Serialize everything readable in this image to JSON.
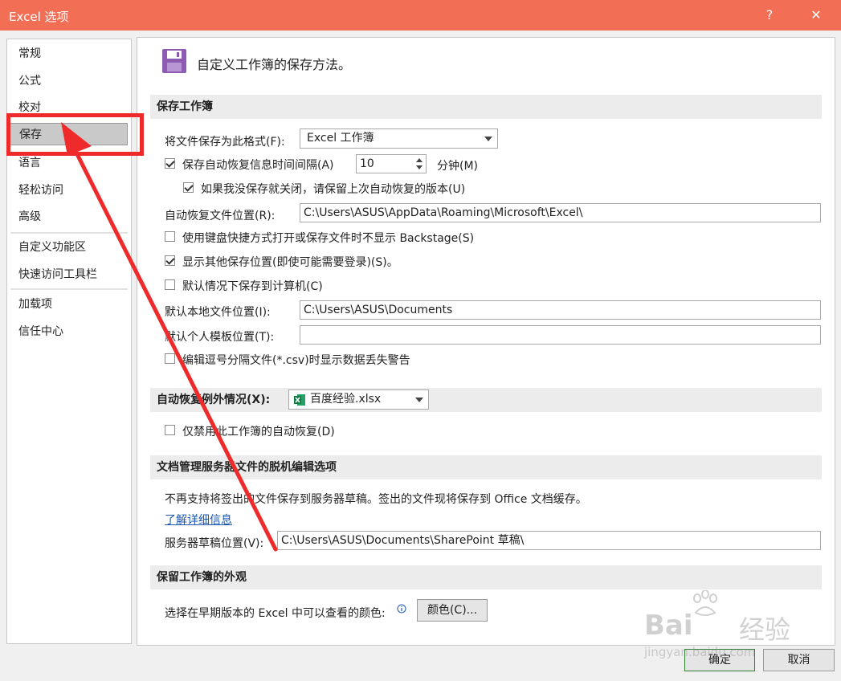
{
  "window": {
    "title": "Excel 选项",
    "help_label": "?",
    "close_label": "✕"
  },
  "sidebar": {
    "items": [
      {
        "label": "常规"
      },
      {
        "label": "公式"
      },
      {
        "label": "校对"
      },
      {
        "label": "保存"
      },
      {
        "label": "语言"
      },
      {
        "label": "轻松访问"
      },
      {
        "label": "高级"
      },
      {
        "label": "自定义功能区"
      },
      {
        "label": "快速访问工具栏"
      },
      {
        "label": "加载项"
      },
      {
        "label": "信任中心"
      }
    ],
    "selected": "保存"
  },
  "header": {
    "title": "自定义工作簿的保存方法。",
    "icon": "floppy-disk-icon"
  },
  "save_workbooks": {
    "section_title": "保存工作簿",
    "format_label": "将文件保存为此格式(F):",
    "format_value": "Excel 工作簿",
    "autorecover_label": "保存自动恢复信息时间间隔(A)",
    "autorecover_checked": true,
    "autorecover_minutes": "10",
    "minutes_label": "分钟(M)",
    "keep_last_label": "如果我没保存就关闭，请保留上次自动恢复的版本(U)",
    "keep_last_checked": true,
    "autorecover_location_label": "自动恢复文件位置(R):",
    "autorecover_location_value": "C:\\Users\\ASUS\\AppData\\Roaming\\Microsoft\\Excel\\",
    "no_backstage_label": "使用键盘快捷方式打开或保存文件时不显示 Backstage(S)",
    "no_backstage_checked": false,
    "show_other_locations_label": "显示其他保存位置(即使可能需要登录)(S)。",
    "show_other_locations_checked": true,
    "save_to_computer_label": "默认情况下保存到计算机(C)",
    "save_to_computer_checked": false,
    "local_location_label": "默认本地文件位置(I):",
    "local_location_value": "C:\\Users\\ASUS\\Documents",
    "template_location_label": "默认个人模板位置(T):",
    "template_location_value": "",
    "csv_warning_label": "编辑逗号分隔文件(*.csv)时显示数据丢失警告",
    "csv_warning_checked": false
  },
  "autorecover_exceptions": {
    "section_title": "自动恢复例外情况(X):",
    "workbook_value": "百度经验.xlsx",
    "disable_label": "仅禁用此工作簿的自动恢复(D)",
    "disable_checked": false
  },
  "offline_editing": {
    "section_title": "文档管理服务器文件的脱机编辑选项",
    "info_text": "不再支持将签出的文件保存到服务器草稿。签出的文件现将保存到 Office 文档缓存。",
    "learn_more_label": "了解详细信息",
    "drafts_location_label": "服务器草稿位置(V):",
    "drafts_location_value": "C:\\Users\\ASUS\\Documents\\SharePoint 草稿\\"
  },
  "preserve_appearance": {
    "section_title": "保留工作簿的外观",
    "colors_label": "选择在早期版本的 Excel 中可以查看的颜色:",
    "colors_button": "颜色(C)..."
  },
  "footer": {
    "ok_label": "确定",
    "cancel_label": "取消"
  },
  "watermark": {
    "brand": "Bai",
    "brand_cn": "经验",
    "url": "jingyan.baidu.com"
  },
  "colors": {
    "titlebar": "#f26e55",
    "annotation": "#ee2a2a",
    "icon": "#8e5bb3",
    "link": "#1a56b4"
  }
}
